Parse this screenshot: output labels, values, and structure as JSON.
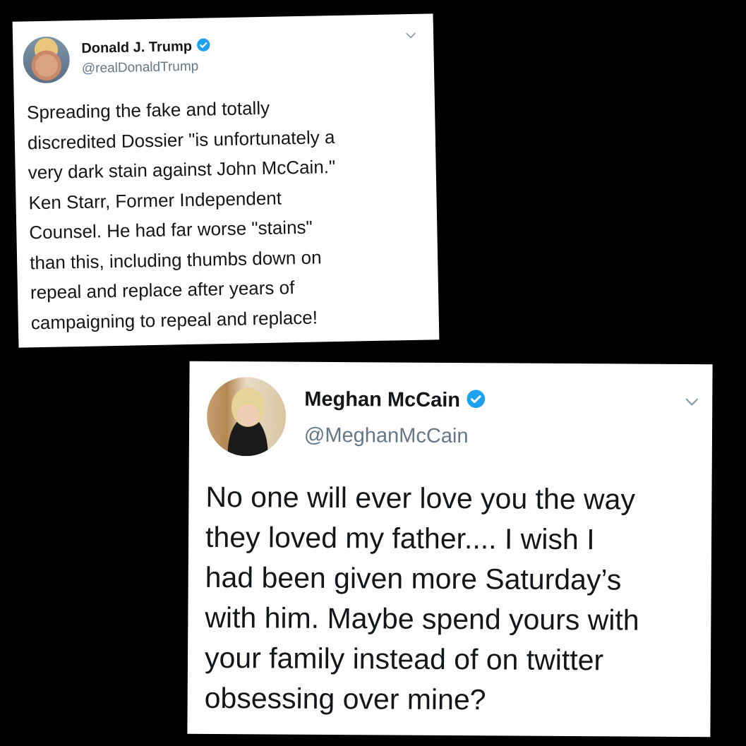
{
  "tweets": [
    {
      "display_name": "Donald J. Trump",
      "handle": "@realDonaldTrump",
      "verified": true,
      "avatar_icon": "profile-photo",
      "menu_icon": "chevron-down-icon",
      "text_lines": [
        "Spreading the fake and totally",
        "discredited Dossier \"is unfortunately a",
        "very dark stain against John McCain.\"",
        "Ken Starr, Former Independent",
        "Counsel. He had far worse \"stains\"",
        "than this, including thumbs down on",
        "repeal and replace after years of",
        "campaigning to repeal and replace!"
      ]
    },
    {
      "display_name": "Meghan McCain",
      "handle": "@MeghanMcCain",
      "verified": true,
      "avatar_icon": "profile-photo",
      "menu_icon": "chevron-down-icon",
      "text_lines": [
        "No one will ever love you the way",
        "they loved my father.... I wish I",
        "had been given more Saturday’s",
        "with him. Maybe spend yours with",
        "your family instead of on twitter",
        "obsessing over mine?"
      ]
    }
  ],
  "colors": {
    "background": "#000000",
    "card": "#ffffff",
    "text": "#14171a",
    "secondary_text": "#657786",
    "verified_badge": "#1da1f2",
    "chevron": "#8899a6"
  }
}
